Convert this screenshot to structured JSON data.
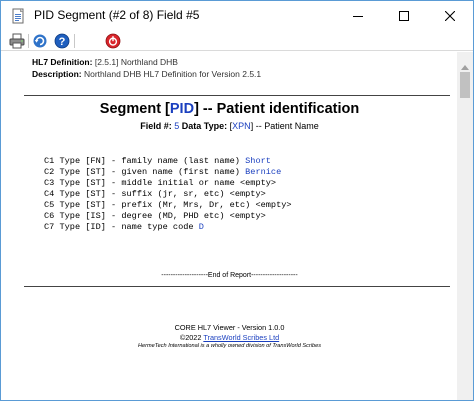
{
  "window": {
    "title": "PID Segment (#2 of 8) Field #5",
    "icons": {
      "app": "document-app-icon",
      "minimize": "minimize-icon",
      "maximize": "maximize-icon",
      "close": "close-icon"
    }
  },
  "toolbar": {
    "icons": [
      "printer-icon",
      "refresh-icon",
      "help-icon",
      "stop-icon"
    ]
  },
  "definition": {
    "hl7_label": "HL7 Definition:",
    "hl7_value": "[2.5.1] Northland DHB",
    "desc_label": "Description:",
    "desc_value": "Northland DHB HL7 Definition for Version 2.5.1"
  },
  "segment": {
    "prefix": "Segment [",
    "code": "PID",
    "suffix": "] -- Patient identification"
  },
  "field": {
    "field_label": "Field #:",
    "field_num": "5",
    "type_label": "Data Type:",
    "type_open": "[",
    "type_code": "XPN",
    "type_close": "]",
    "type_desc": "-- Patient Name"
  },
  "components": [
    {
      "text": "C1 Type [FN] - family name (last name) ",
      "value": "Short"
    },
    {
      "text": "C2 Type [ST] - given name (first name) ",
      "value": "Bernice"
    },
    {
      "text": "C3 Type [ST] - middle initial or name ",
      "value": "<empty>"
    },
    {
      "text": "C4 Type [ST] - suffix (jr, sr, etc) ",
      "value": "<empty>"
    },
    {
      "text": "C5 Type [ST] - prefix (Mr, Mrs, Dr, etc) ",
      "value": "<empty>"
    },
    {
      "text": "C6 Type [IS] - degree (MD, PHD etc) ",
      "value": "<empty>"
    },
    {
      "text": "C7 Type [ID] - name type code ",
      "value": "D"
    }
  ],
  "end_of_report": "--------------------End of Report--------------------",
  "footer": {
    "line1": "CORE HL7 Viewer - Version 1.0.0",
    "copyright": "©2022 ",
    "link": "TransWorld Scribes Ltd",
    "line3": "HermeTech International is a wholly owned division of TransWorld Scribes"
  },
  "colors": {
    "accent": "#1a3fbf",
    "window_border": "#5a9bd5",
    "stop_red": "#d9252b"
  }
}
